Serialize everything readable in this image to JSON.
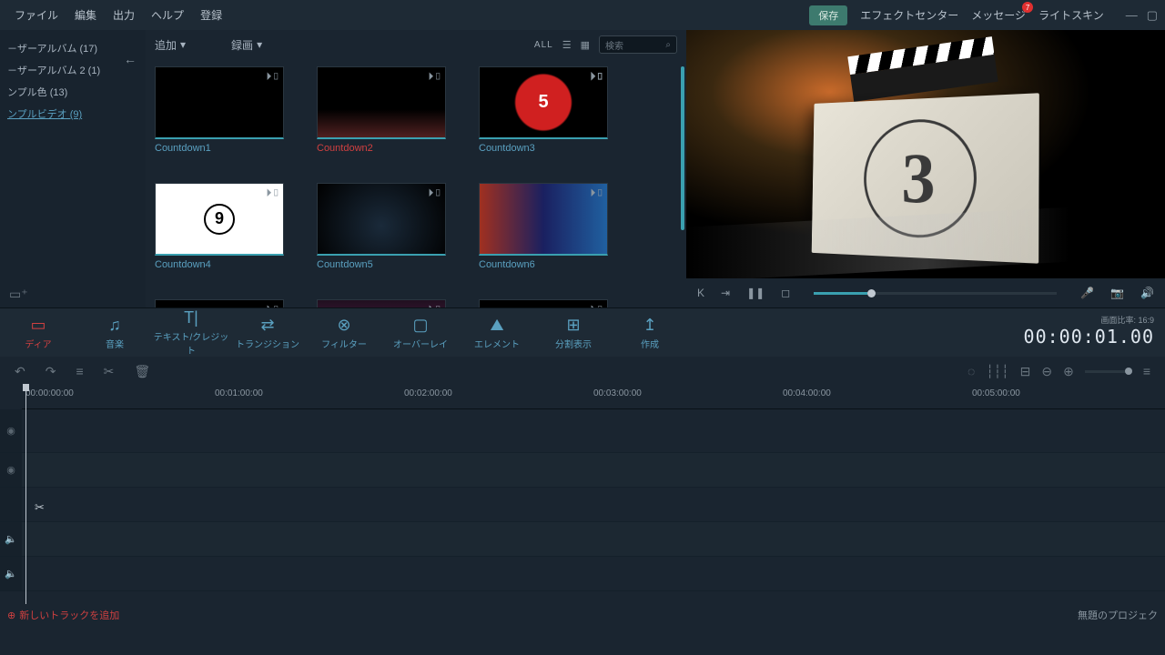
{
  "menu": {
    "file": "ファイル",
    "edit": "編集",
    "output": "出力",
    "help": "ヘルプ",
    "register": "登録"
  },
  "topRight": {
    "save": "保存",
    "effectCenter": "エフェクトセンター",
    "message": "メッセージ",
    "msgBadge": "7",
    "lightSkin": "ライトスキン"
  },
  "sidebar": {
    "items": [
      {
        "label": "－ザーアルバム (17)"
      },
      {
        "label": "－ザーアルバム 2 (1)"
      },
      {
        "label": "ンプル色 (13)"
      },
      {
        "label": "ンプルビデオ (9)"
      }
    ]
  },
  "mediaToolbar": {
    "add": "追加",
    "record": "録画",
    "all": "ALL",
    "searchPlaceholder": "検索"
  },
  "media": [
    {
      "label": "Countdown1"
    },
    {
      "label": "Countdown2"
    },
    {
      "label": "Countdown3"
    },
    {
      "label": "Countdown4"
    },
    {
      "label": "Countdown5"
    },
    {
      "label": "Countdown6"
    }
  ],
  "preview": {
    "slateNumber": "3"
  },
  "tabs": {
    "media": "ディア",
    "music": "音楽",
    "text": "テキスト/クレジット",
    "transition": "トランジション",
    "filter": "フィルター",
    "overlay": "オーバーレイ",
    "element": "エレメント",
    "split": "分割表示",
    "create": "作成"
  },
  "aspect": {
    "label": "画面比率:",
    "value": "16:9"
  },
  "timecode": "00:00:01.00",
  "ruler": [
    "00:00:00:00",
    "00:01:00:00",
    "00:02:00:00",
    "00:03:00:00",
    "00:04:00:00",
    "00:05:00:00"
  ],
  "footer": {
    "addTrack": "新しいトラックを追加",
    "project": "無題のプロジェク"
  }
}
